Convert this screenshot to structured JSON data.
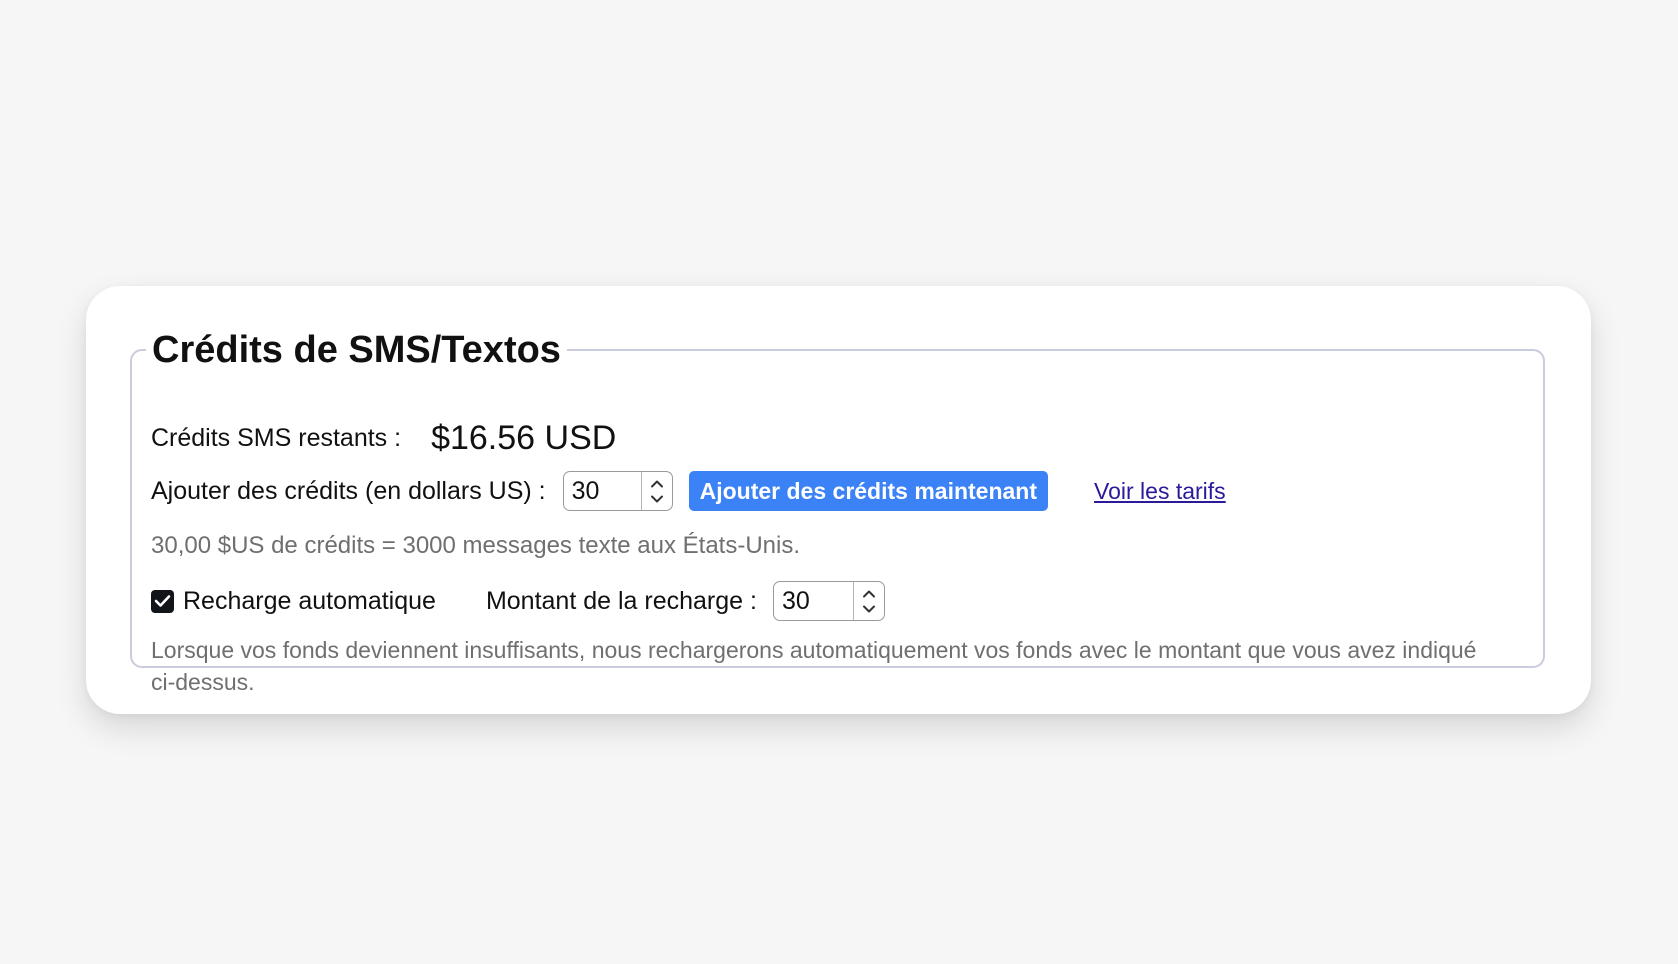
{
  "panel": {
    "title": "Crédits de SMS/Textos",
    "remaining_label": "Crédits SMS restants :",
    "remaining_value": "$16.56 USD",
    "add_label": "Ajouter des crédits (en dollars US) :",
    "add_amount": "30",
    "add_button": "Ajouter des crédits maintenant",
    "pricing_link": "Voir les tarifs",
    "conversion_note": "30,00 $US de crédits = 3000 messages texte aux États-Unis.",
    "auto_recharge_checked": true,
    "auto_recharge_label": "Recharge automatique",
    "recharge_amount_label": "Montant de la recharge :",
    "recharge_amount": "30",
    "auto_recharge_description": "Lorsque vos fonds deviennent insuffisants, nous rechargerons automatiquement vos fonds avec le montant que vous avez indiqué ci-dessus."
  },
  "icons": {
    "checkbox": "check-icon",
    "spin_up": "chevron-up-icon",
    "spin_down": "chevron-down-icon"
  },
  "colors": {
    "primary_button": "#3b82f6",
    "link": "#2a1a9a",
    "fieldset_border": "#c9cbe0",
    "muted_text": "#6f6f6f"
  }
}
